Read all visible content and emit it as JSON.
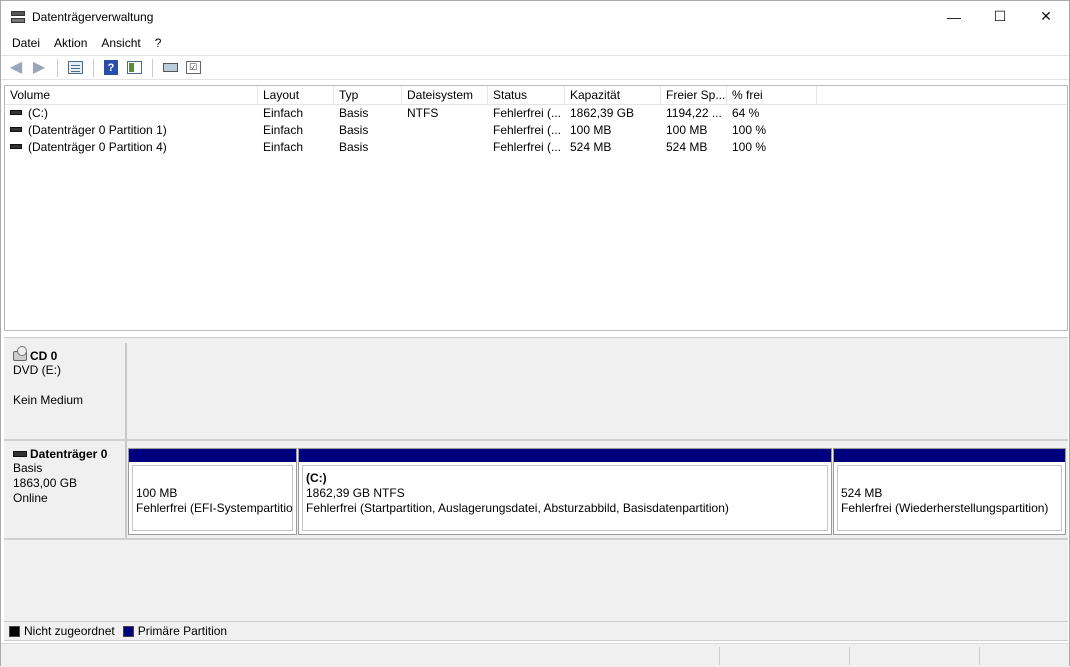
{
  "window": {
    "title": "Datenträgerverwaltung",
    "controls": {
      "minimize": "—",
      "maximize": "☐",
      "close": "✕"
    }
  },
  "menu": {
    "items": [
      {
        "label": "Datei"
      },
      {
        "label": "Aktion"
      },
      {
        "label": "Ansicht"
      },
      {
        "label": "?"
      }
    ]
  },
  "toolbar": {
    "icons": [
      "back-arrow-icon",
      "forward-arrow-icon",
      "properties-icon",
      "help-icon",
      "show-hide-pane-icon",
      "connect-icon",
      "checklist-icon"
    ]
  },
  "volume_list": {
    "columns": [
      {
        "label": "Volume"
      },
      {
        "label": "Layout"
      },
      {
        "label": "Typ"
      },
      {
        "label": "Dateisystem"
      },
      {
        "label": "Status"
      },
      {
        "label": "Kapazität"
      },
      {
        "label": "Freier Sp..."
      },
      {
        "label": "% frei"
      }
    ],
    "rows": [
      {
        "volume": "(C:)",
        "layout": "Einfach",
        "typ": "Basis",
        "fs": "NTFS",
        "status": "Fehlerfrei (...",
        "kapazitaet": "1862,39 GB",
        "frei": "1194,22 ...",
        "prozent": "64 %"
      },
      {
        "volume": "(Datenträger 0 Partition 1)",
        "layout": "Einfach",
        "typ": "Basis",
        "fs": "",
        "status": "Fehlerfrei (...",
        "kapazitaet": "100 MB",
        "frei": "100 MB",
        "prozent": "100 %"
      },
      {
        "volume": "(Datenträger 0 Partition 4)",
        "layout": "Einfach",
        "typ": "Basis",
        "fs": "",
        "status": "Fehlerfrei (...",
        "kapazitaet": "524 MB",
        "frei": "524 MB",
        "prozent": "100 %"
      }
    ]
  },
  "disks": {
    "cd0": {
      "title": "CD 0",
      "line1": "DVD (E:)",
      "line2": "Kein Medium"
    },
    "disk0": {
      "title": "Datenträger 0",
      "line1": "Basis",
      "line2": "1863,00 GB",
      "line3": "Online",
      "partitions": [
        {
          "name": "",
          "size": "100 MB",
          "status": "Fehlerfrei (EFI-Systempartition)"
        },
        {
          "name": "(C:)",
          "size": "1862,39 GB NTFS",
          "status": "Fehlerfrei (Startpartition, Auslagerungsdatei, Absturzabbild, Basisdatenpartition)"
        },
        {
          "name": "",
          "size": "524 MB",
          "status": "Fehlerfrei (Wiederherstellungspartition)"
        }
      ]
    }
  },
  "legend": {
    "items": [
      {
        "label": "Nicht zugeordnet",
        "color": "#000000"
      },
      {
        "label": "Primäre Partition",
        "color": "#00007f"
      }
    ]
  },
  "colors": {
    "primary_partition": "#00007f",
    "unallocated": "#000000"
  }
}
